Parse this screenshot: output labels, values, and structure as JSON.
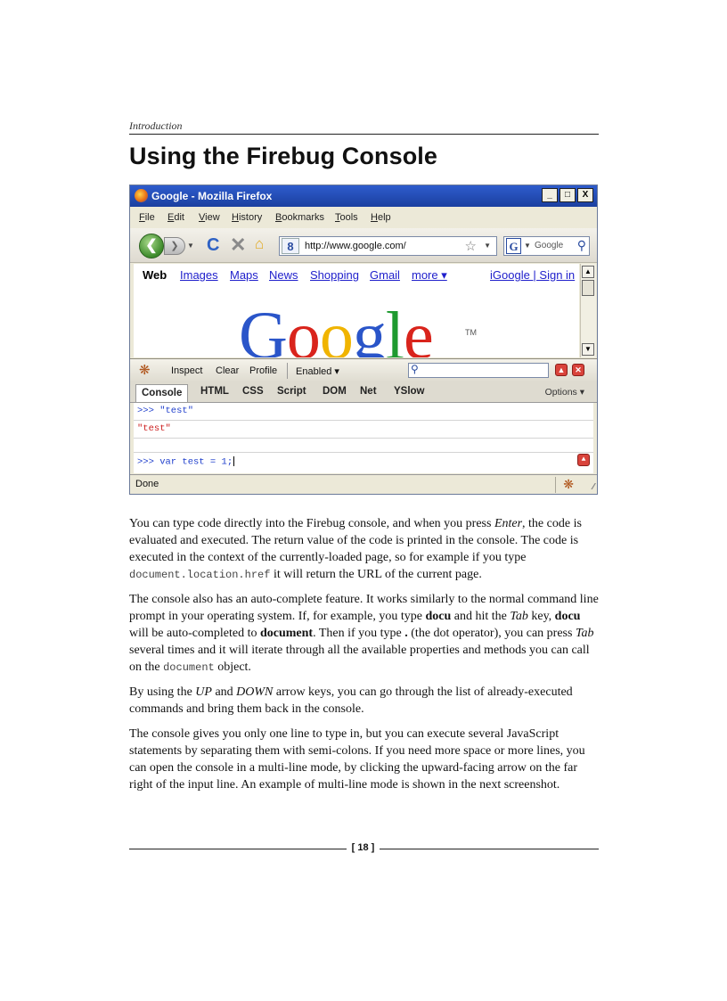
{
  "running_head": "Introduction",
  "chapter_title": "Using the Firebug Console",
  "screenshot": {
    "window_title": "Google - Mozilla Firefox",
    "window_buttons": [
      "_",
      "□",
      "X"
    ],
    "menu": [
      "File",
      "Edit",
      "View",
      "History",
      "Bookmarks",
      "Tools",
      "Help"
    ],
    "url": "http://www.google.com/",
    "url_favicon": "8",
    "search_engine_letter": "G",
    "search_placeholder": "Google",
    "google_nav": {
      "web": "Web",
      "links": [
        "Images",
        "Maps",
        "News",
        "Shopping",
        "Gmail",
        "more ▾"
      ],
      "right": "iGoogle | Sign in"
    },
    "logo_letters": [
      "G",
      "o",
      "o",
      "g",
      "l",
      "e"
    ],
    "logo_colors": [
      "#2a55c9",
      "#d9241c",
      "#f0b400",
      "#2a55c9",
      "#1e9a2f",
      "#d9241c"
    ],
    "logo_tm": "TM",
    "firebug_toolbar": [
      "Inspect",
      "Clear",
      "Profile",
      "Enabled ▾"
    ],
    "firebug_tabs": [
      "Console",
      "HTML",
      "CSS",
      "Script",
      "DOM",
      "Net",
      "YSlow"
    ],
    "options_label": "Options ▾",
    "console": {
      "command_1": ">>> \"test\"",
      "result_1": "\"test\"",
      "input": ">>> var test = 1;"
    },
    "status": "Done"
  },
  "body": {
    "p1": {
      "a": "You can type code directly into the Firebug console, and when you press ",
      "enter": "Enter",
      "b": ", the code is evaluated and executed. The return value of the code is printed in the console. The code is executed in the context of the currently-loaded page, so for example if you type ",
      "code": "document.location.href",
      "c": " it will return the URL of the current page."
    },
    "p2": {
      "a": "The console also has an auto-complete feature. It works similarly to the normal command line prompt in your operating system. If, for example, you type ",
      "docu1": "docu",
      "b": " and hit the ",
      "tab1": "Tab",
      "c": " key, ",
      "docu2": "docu",
      "d": " will be auto-completed to ",
      "document": "document",
      "e": ". Then if you type ",
      "dot": ".",
      "f": " (the dot operator), you can press ",
      "tab2": "Tab",
      "g": " several times and it will iterate through all the available properties and methods you can call on the ",
      "code": "document",
      "h": " object."
    },
    "p3": {
      "a": "By using the ",
      "up": "UP",
      "b": " and ",
      "down": "DOWN",
      "c": " arrow keys, you can go through the list of already-executed commands and bring them back in the console."
    },
    "p4": "The console gives you only one line to type in, but you can execute several JavaScript statements by separating them with semi-colons. If you need more space or more lines, you can open the console in a multi-line mode, by clicking the upward-facing arrow on the far right of the input line. An example of multi-line mode is shown in the next screenshot."
  },
  "page_number": "[ 18 ]"
}
